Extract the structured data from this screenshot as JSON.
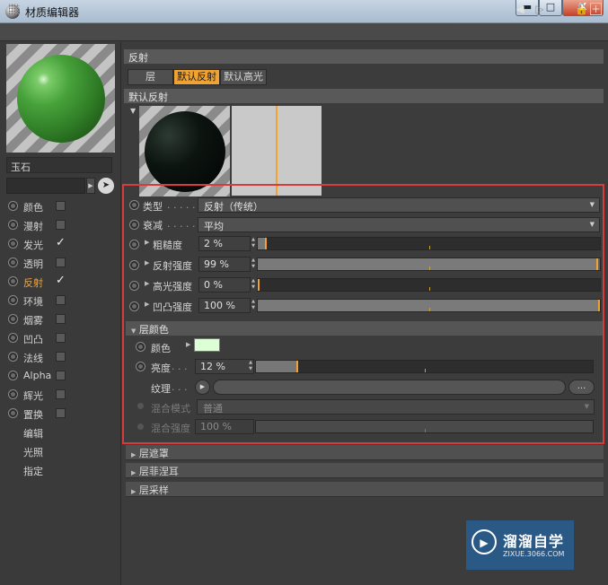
{
  "window": {
    "title": "材质编辑器",
    "min_icon": "minimize-icon",
    "max_icon": "maximize-icon",
    "close_icon": "close-icon",
    "min_glyph": "▬",
    "max_glyph": "□",
    "close_glyph": "X"
  },
  "toolbar": {
    "nav_back_glyph": "◀",
    "nav_forward_glyph": "▷",
    "lock_glyph": "🔓",
    "add_glyph": "+"
  },
  "left": {
    "material_name": "玉石",
    "channels": [
      {
        "label": "颜色",
        "checked": false,
        "active": false
      },
      {
        "label": "漫射",
        "checked": false,
        "active": false
      },
      {
        "label": "发光",
        "checked": true,
        "active": false
      },
      {
        "label": "透明",
        "checked": false,
        "active": false
      },
      {
        "label": "反射",
        "checked": true,
        "active": true
      },
      {
        "label": "环境",
        "checked": false,
        "active": false
      },
      {
        "label": "烟雾",
        "checked": false,
        "active": false
      },
      {
        "label": "凹凸",
        "checked": false,
        "active": false
      },
      {
        "label": "法线",
        "checked": false,
        "active": false
      },
      {
        "label": "Alpha",
        "checked": false,
        "active": false
      },
      {
        "label": "辉光",
        "checked": false,
        "active": false
      },
      {
        "label": "置换",
        "checked": false,
        "active": false
      }
    ],
    "extras": [
      "编辑",
      "光照",
      "指定"
    ],
    "check_glyph": "✓"
  },
  "reflection": {
    "section_title": "反射",
    "tabs": [
      "层",
      "默认反射",
      "默认高光"
    ],
    "active_tab": 1,
    "layer_title": "默认反射",
    "falloff_marker": 0.5,
    "type_label": "类型",
    "type_value": "反射（传统）",
    "attenuation_label": "衰减",
    "attenuation_value": "平均",
    "params": [
      {
        "label": "粗糙度",
        "value": "2 %",
        "fraction": 0.02
      },
      {
        "label": "反射强度",
        "value": "99 %",
        "fraction": 0.99
      },
      {
        "label": "高光强度",
        "value": "0 %",
        "fraction": 0.0
      },
      {
        "label": "凹凸强度",
        "value": "100 %",
        "fraction": 1.0
      }
    ],
    "layer_color": {
      "title": "层颜色",
      "color_label": "颜色",
      "swatch": "#dcffd6",
      "brightness_label": "亮度",
      "brightness_value": "12 %",
      "brightness_fraction": 0.12,
      "texture_label": "纹理",
      "texture_btn": "...",
      "blend_mode_label": "混合模式",
      "blend_mode_value": "普通",
      "blend_strength_label": "混合强度",
      "blend_strength_value": "100 %"
    },
    "collapsed_sections": [
      "层遮罩",
      "层菲涅耳",
      "层采样"
    ],
    "dots": ". . . . ."
  },
  "watermark": {
    "title": "溜溜自学",
    "url": "ZIXUE.3066.COM"
  },
  "colors": {
    "accent": "#f0a332",
    "highlight_box": "#d93b3b",
    "material": "#47a23a"
  }
}
